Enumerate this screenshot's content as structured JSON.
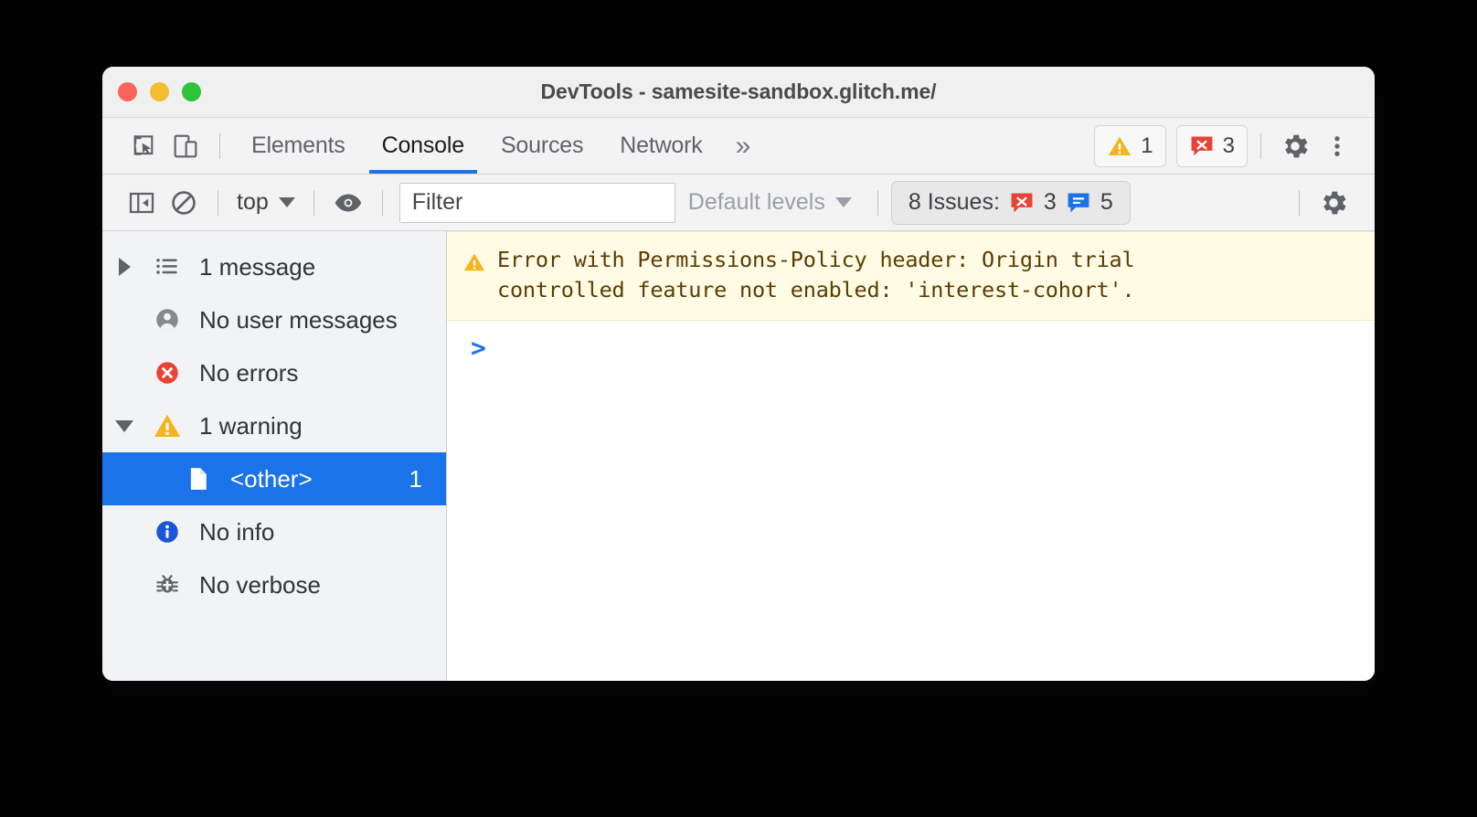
{
  "window": {
    "title": "DevTools - samesite-sandbox.glitch.me/",
    "traffic_lights": [
      "close",
      "minimize",
      "maximize"
    ],
    "colors": {
      "close": "#f9655d",
      "minimize": "#f2bd2f",
      "maximize": "#2fc23b",
      "accent": "#1a73e8",
      "warning": "#f5a623",
      "error": "#ea4335",
      "issue_blue": "#1a73e8",
      "warning_bg": "#fffbe5",
      "warning_text": "#5c3c00"
    }
  },
  "toolbar": {
    "inspect_icon": "inspect-element-icon",
    "device_icon": "device-toolbar-icon",
    "tabs": [
      {
        "label": "Elements",
        "active": false
      },
      {
        "label": "Console",
        "active": true
      },
      {
        "label": "Sources",
        "active": false
      },
      {
        "label": "Network",
        "active": false
      }
    ],
    "more_tabs_label": "»",
    "warning_count": "1",
    "error_count": "3",
    "settings_icon": "gear-icon",
    "more_options_icon": "kebab-menu-icon"
  },
  "filterbar": {
    "sidebar_toggle_icon": "console-sidebar-toggle-icon",
    "clear_console_icon": "clear-console-icon",
    "context_value": "top",
    "live_expression_icon": "eye-icon",
    "filter_placeholder": "Filter",
    "filter_value": "",
    "levels_value": "Default levels",
    "issues_label": "8 Issues:",
    "issues_error_count": "3",
    "issues_info_count": "5",
    "console_settings_icon": "gear-icon"
  },
  "sidebar": {
    "items": [
      {
        "label": "1 message",
        "icon": "list-icon",
        "twisty": "collapsed",
        "count": "",
        "selected": false,
        "indent": 0
      },
      {
        "label": "No user messages",
        "icon": "person-icon",
        "twisty": "none",
        "count": "",
        "selected": false,
        "indent": 0
      },
      {
        "label": "No errors",
        "icon": "error-icon",
        "twisty": "none",
        "count": "",
        "selected": false,
        "indent": 0
      },
      {
        "label": "1 warning",
        "icon": "warning-icon",
        "twisty": "expanded",
        "count": "",
        "selected": false,
        "indent": 0
      },
      {
        "label": "<other>",
        "icon": "file-icon",
        "twisty": "none",
        "count": "1",
        "selected": true,
        "indent": 1
      },
      {
        "label": "No info",
        "icon": "info-icon",
        "twisty": "none",
        "count": "",
        "selected": false,
        "indent": 0
      },
      {
        "label": "No verbose",
        "icon": "bug-icon",
        "twisty": "none",
        "count": "",
        "selected": false,
        "indent": 0
      }
    ]
  },
  "console": {
    "messages": [
      {
        "level": "warning",
        "icon": "warning-icon",
        "text": "Error with Permissions-Policy header: Origin trial\ncontrolled feature not enabled: 'interest-cohort'."
      }
    ],
    "prompt_symbol": ">"
  }
}
